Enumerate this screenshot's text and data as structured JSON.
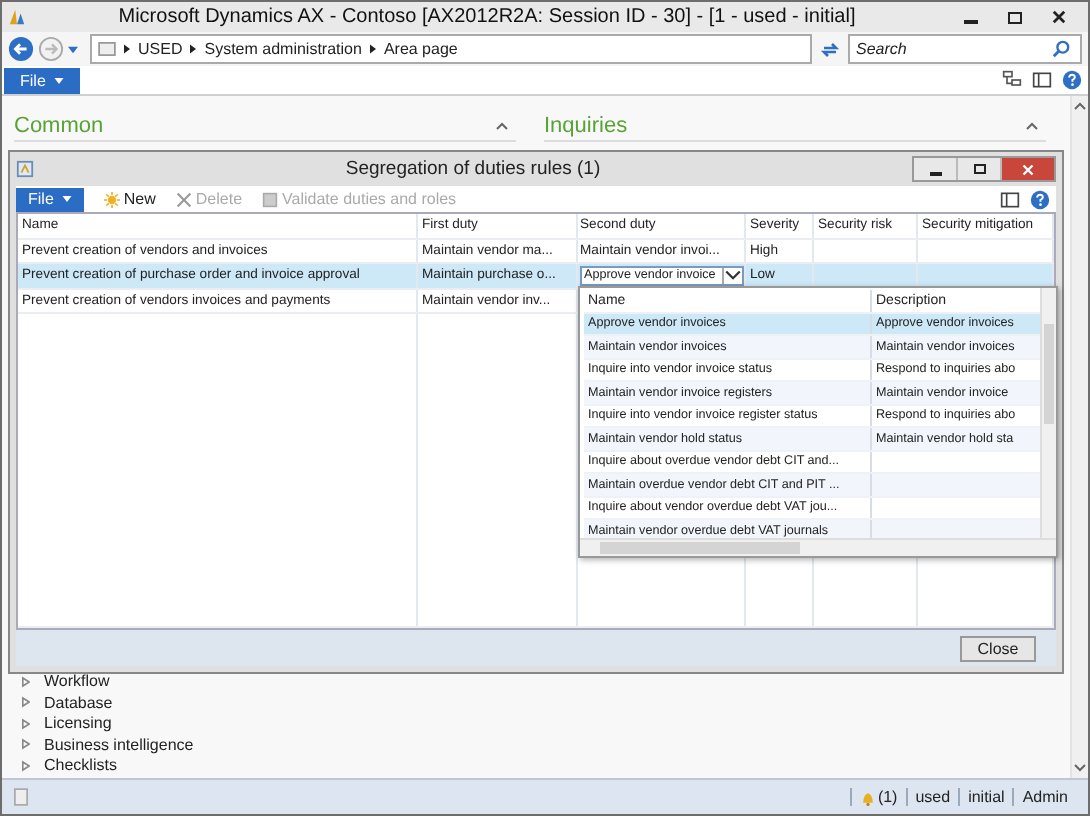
{
  "window": {
    "title": "Microsoft Dynamics AX - Contoso [AX2012R2A: Session ID - 30] -  [1 - used - initial]"
  },
  "nav": {
    "breadcrumbs": [
      "USED",
      "System administration",
      "Area page"
    ],
    "search_placeholder": "Search"
  },
  "file_menu": "File",
  "sections": [
    "Common",
    "Inquiries"
  ],
  "tree": [
    {
      "label": "Workflow",
      "expanded": false
    },
    {
      "label": "Database",
      "expanded": false
    },
    {
      "label": "Licensing",
      "expanded": false
    },
    {
      "label": "Business intelligence",
      "expanded": false
    },
    {
      "label": "Checklists",
      "expanded": false
    }
  ],
  "dialog": {
    "title": "Segregation of duties rules (1)",
    "file_menu": "File",
    "actions": [
      {
        "kind": "new",
        "label": "New",
        "disabled": false
      },
      {
        "kind": "delete",
        "label": "Delete",
        "disabled": true
      },
      {
        "kind": "validate",
        "label": "Validate duties and roles",
        "disabled": true
      }
    ],
    "columns": [
      "Name",
      "First duty",
      "Second duty",
      "Severity",
      "Security risk",
      "Security mitigation"
    ],
    "rows": [
      {
        "name": "Prevent creation of vendors and invoices",
        "first_duty": "Maintain vendor ma...",
        "second_duty": "Maintain vendor invoi...",
        "severity": "High",
        "selected": false
      },
      {
        "name": "Prevent creation of purchase order and invoice approval",
        "first_duty": "Maintain purchase o...",
        "second_duty": "Approve vendor invoice",
        "severity": "Low",
        "selected": true
      },
      {
        "name": "Prevent creation of vendors invoices and payments",
        "first_duty": "Maintain vendor inv...",
        "selected": false
      }
    ],
    "lookup": {
      "columns": [
        "Name",
        "Description"
      ],
      "rows": [
        {
          "name": "Approve vendor invoices",
          "description": "Approve vendor invoices",
          "selected": true
        },
        {
          "name": "Maintain vendor invoices",
          "description": "Maintain vendor invoices",
          "selected": false
        },
        {
          "name": "Inquire into vendor invoice status",
          "description": "Respond to inquiries abo",
          "selected": false
        },
        {
          "name": "Maintain vendor invoice registers",
          "description": "Maintain vendor invoice",
          "selected": false
        },
        {
          "name": "Inquire into vendor invoice register status",
          "description": "Respond to inquiries abo",
          "selected": false
        },
        {
          "name": "Maintain vendor hold status",
          "description": "Maintain vendor hold sta",
          "selected": false
        },
        {
          "name": "Inquire about overdue vendor debt CIT and...",
          "selected": false
        },
        {
          "name": "Maintain overdue vendor debt CIT and PIT ...",
          "selected": false
        },
        {
          "name": "Inquire about vendor overdue debt VAT jou...",
          "selected": false
        },
        {
          "name": "Maintain vendor overdue debt VAT journals",
          "selected": false
        }
      ]
    },
    "close": "Close"
  },
  "status_bar": {
    "alerts": "(1)",
    "items": [
      "used",
      "initial",
      "Admin"
    ]
  }
}
